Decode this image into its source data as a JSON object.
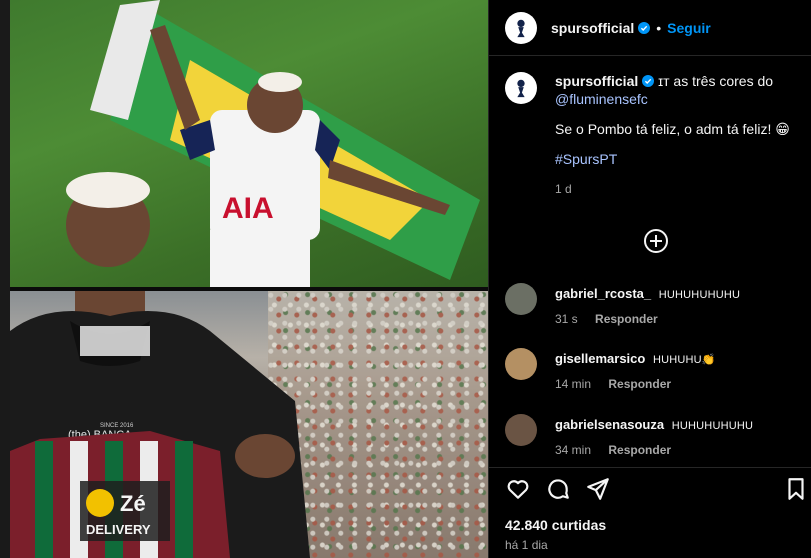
{
  "post": {
    "author": "spursofficial",
    "follow_label": "Seguir",
    "separator": "•"
  },
  "caption": {
    "author": "spursofficial",
    "prefix": "ɪт as três cores do",
    "mention": "@fluminensefc",
    "line2": "Se o Pombo tá feliz, o adm tá feliz! 😁",
    "hashtag": "#SpursPT",
    "age": "1 d"
  },
  "comments": [
    {
      "user": "gabriel_rcosta_",
      "text": "HUHUHUHUHU",
      "age": "31 s",
      "reply": "Responder",
      "avatar_color": "#6b6f64"
    },
    {
      "user": "gisellemarsico",
      "text": "HUHUHU👏",
      "age": "14 min",
      "reply": "Responder",
      "avatar_color": "#b49063"
    },
    {
      "user": "gabrielsenasouza",
      "text": "HUHUHUHUHU",
      "age": "34 min",
      "reply": "Responder",
      "avatar_color": "#6a5444"
    }
  ],
  "stats": {
    "likes": "42.840 curtidas",
    "date": "há 1 dia"
  },
  "media": {
    "top_shirt_sponsor": "AIA",
    "bottom_hoodie_text": "(the) BANCA",
    "bottom_hoodie_sub": "SINCE 2016",
    "bottom_shirt_sponsor_1": "Zé",
    "bottom_shirt_sponsor_2": "DELIVERY"
  },
  "colors": {
    "accent_blue": "#0095f6",
    "verified_blue": "#0095f6",
    "muted": "#a8a8a8",
    "background": "#000000"
  }
}
